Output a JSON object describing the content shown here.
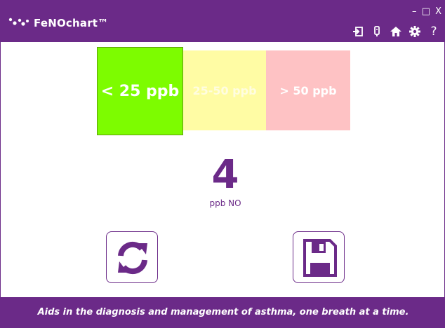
{
  "app": {
    "title": "FeNOchart™",
    "window_controls": {
      "minimize": "–",
      "maximize": "□",
      "close": "X"
    }
  },
  "toolbar": {
    "icons": [
      "exit-icon",
      "device-icon",
      "home-icon",
      "settings-icon",
      "help-icon"
    ],
    "help_label": "?"
  },
  "ranges": [
    {
      "label": "< 25 ppb",
      "color": "#7dfc00",
      "selected": true
    },
    {
      "label": "25-50 ppb",
      "color": "#fffca4",
      "selected": false
    },
    {
      "label": "> 50 ppb",
      "color": "#fec2c4",
      "selected": false
    }
  ],
  "reading": {
    "value": "4",
    "unit": "ppb NO"
  },
  "actions": {
    "icons": [
      "refresh-icon",
      "save-icon"
    ]
  },
  "footer": {
    "tagline": "Aids in the diagnosis and management of asthma, one breath at a time."
  },
  "colors": {
    "brand": "#6b2a88"
  }
}
